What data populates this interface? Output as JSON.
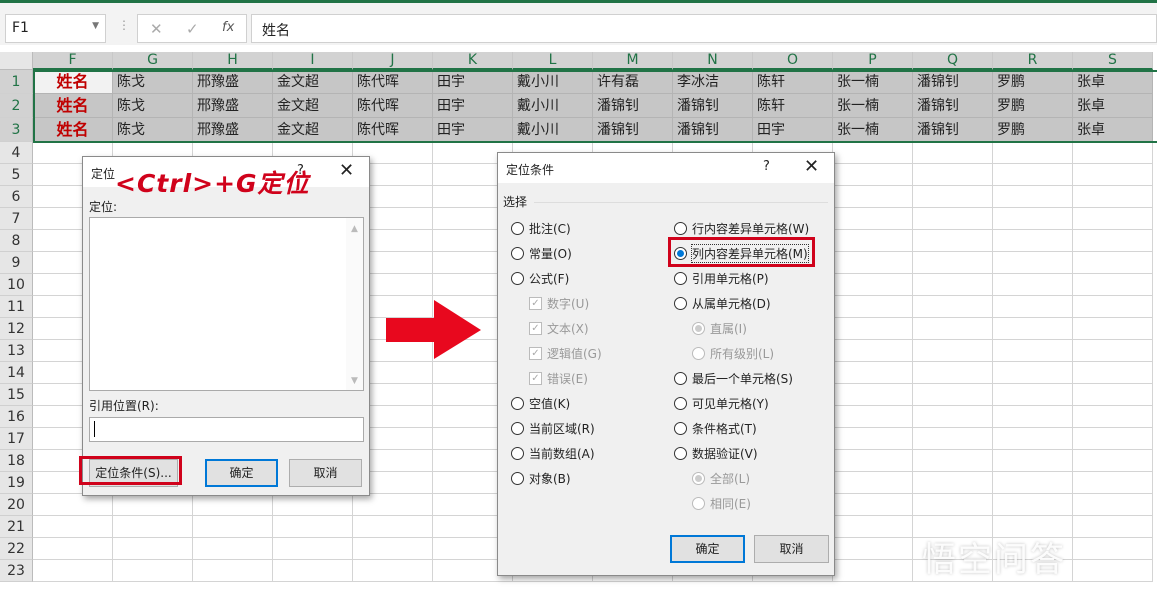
{
  "namebox": "F1",
  "formula_icons": {
    "cancel": "✕",
    "enter": "✓",
    "fx": "fx"
  },
  "formula": "姓名",
  "columns": [
    "F",
    "G",
    "H",
    "I",
    "J",
    "K",
    "L",
    "M",
    "N",
    "O",
    "P",
    "Q",
    "R",
    "S"
  ],
  "row_numbers": [
    "1",
    "2",
    "3",
    "4",
    "5",
    "6",
    "7",
    "8",
    "9",
    "10",
    "11",
    "12",
    "13",
    "14",
    "15",
    "16",
    "17",
    "18",
    "19",
    "20",
    "21",
    "22",
    "23"
  ],
  "rows": [
    [
      "姓名",
      "陈戈",
      "邢豫盛",
      "金文超",
      "陈代晖",
      "田宇",
      "戴小川",
      "许有磊",
      "李冰洁",
      "陈轩",
      "张一楠",
      "潘锦钊",
      "罗鹏",
      "张卓"
    ],
    [
      "姓名",
      "陈戈",
      "邢豫盛",
      "金文超",
      "陈代晖",
      "田宇",
      "戴小川",
      "潘锦钊",
      "潘锦钊",
      "陈轩",
      "张一楠",
      "潘锦钊",
      "罗鹏",
      "张卓"
    ],
    [
      "姓名",
      "陈戈",
      "邢豫盛",
      "金文超",
      "陈代晖",
      "田宇",
      "戴小川",
      "潘锦钊",
      "潘锦钊",
      "田宇",
      "张一楠",
      "潘锦钊",
      "罗鹏",
      "张卓"
    ]
  ],
  "goto": {
    "title": "定位",
    "help": "?",
    "close": "✕",
    "list_label": "定位:",
    "ref_label": "引用位置(R):",
    "ref_value": "",
    "special": "定位条件(S)...",
    "ok": "确定",
    "cancel": "取消"
  },
  "annotation": "<Ctrl>+G定位",
  "special": {
    "title": "定位条件",
    "help": "?",
    "close": "✕",
    "group": "选择",
    "left": [
      {
        "label": "批注(C)",
        "type": "radio",
        "state": "off"
      },
      {
        "label": "常量(O)",
        "type": "radio",
        "state": "off"
      },
      {
        "label": "公式(F)",
        "type": "radio",
        "state": "off"
      },
      {
        "label": "数字(U)",
        "type": "check",
        "state": "dis"
      },
      {
        "label": "文本(X)",
        "type": "check",
        "state": "dis"
      },
      {
        "label": "逻辑值(G)",
        "type": "check",
        "state": "dis"
      },
      {
        "label": "错误(E)",
        "type": "check",
        "state": "dis"
      },
      {
        "label": "空值(K)",
        "type": "radio",
        "state": "off"
      },
      {
        "label": "当前区域(R)",
        "type": "radio",
        "state": "off"
      },
      {
        "label": "当前数组(A)",
        "type": "radio",
        "state": "off"
      },
      {
        "label": "对象(B)",
        "type": "radio",
        "state": "off"
      }
    ],
    "right": [
      {
        "label": "行内容差异单元格(W)",
        "type": "radio",
        "state": "off"
      },
      {
        "label": "列内容差异单元格(M)",
        "type": "radio",
        "state": "on"
      },
      {
        "label": "引用单元格(P)",
        "type": "radio",
        "state": "off"
      },
      {
        "label": "从属单元格(D)",
        "type": "radio",
        "state": "off"
      },
      {
        "label": "直属(I)",
        "type": "radio",
        "state": "dison",
        "indent": true
      },
      {
        "label": "所有级别(L)",
        "type": "radio",
        "state": "dis",
        "indent": true
      },
      {
        "label": "最后一个单元格(S)",
        "type": "radio",
        "state": "off"
      },
      {
        "label": "可见单元格(Y)",
        "type": "radio",
        "state": "off"
      },
      {
        "label": "条件格式(T)",
        "type": "radio",
        "state": "off"
      },
      {
        "label": "数据验证(V)",
        "type": "radio",
        "state": "off"
      },
      {
        "label": "全部(L)",
        "type": "radio",
        "state": "dison",
        "indent": true
      },
      {
        "label": "相同(E)",
        "type": "radio",
        "state": "dis",
        "indent": true
      }
    ],
    "ok": "确定",
    "cancel": "取消"
  },
  "watermark": "悟空问答",
  "colors": {
    "accent": "#217346",
    "red": "#d0021b",
    "blue": "#0078d7"
  }
}
